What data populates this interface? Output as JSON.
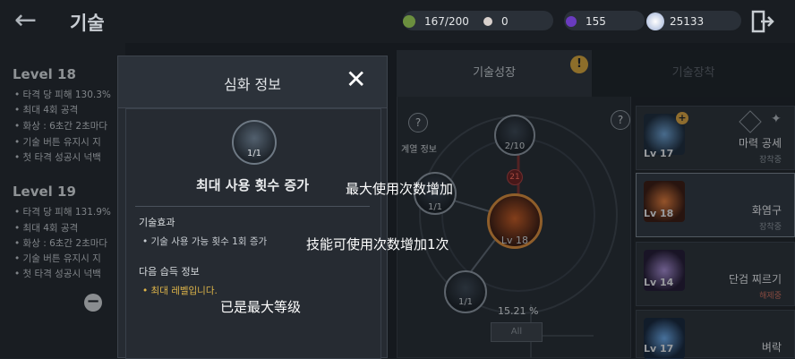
{
  "header": {
    "title": "기술"
  },
  "resources": [
    {
      "icon": "stamina-icon",
      "value": "167/200",
      "color": "#6b8f3e"
    },
    {
      "icon": "pearl-icon",
      "value": "0",
      "color": "#d8d0cc"
    },
    {
      "icon": "orb-icon",
      "value": "155",
      "color": "#6a3bbf"
    },
    {
      "icon": "crystal-icon",
      "value": "25133",
      "color": "#e8eef8"
    }
  ],
  "left": {
    "levels": [
      {
        "title": "Level 18",
        "lines": [
          "타격 당 피해 130.3%",
          "최대 4회 공격",
          "화상 : 6초간 2초마다",
          "기술 버튼 유지시 지",
          "첫 타격 성공시 넉백"
        ]
      },
      {
        "title": "Level 19",
        "lines": [
          "타격 당 피해 131.9%",
          "최대 4회 공격",
          "화상 : 6초간 2초마다",
          "기술 버튼 유지시 지",
          "첫 타격 성공시 넉백"
        ]
      }
    ]
  },
  "modal": {
    "title": "심화 정보",
    "skill_fraction": "1/1",
    "skill_name": "최대 사용 횟수 증가",
    "effect_header": "기술효과",
    "effect_line": "기술 사용 가능 횟수 1회 증가",
    "next_header": "다음 습득 정보",
    "next_line": "최대 레벨입니다."
  },
  "overlays": {
    "line1": "最大使用次数增加",
    "line2": "技能可使用次数增加1次",
    "line3": "已是最大等级"
  },
  "tabs": {
    "growth": "기술성장",
    "equip": "기술장착"
  },
  "tree": {
    "lineage_label": "계열 정보",
    "top_node": "2/10",
    "badge": "21",
    "left_node": "1/1",
    "center_level": "Lv 18",
    "bottom_node": "1/1",
    "percent": "15.21 %",
    "all_button": "All"
  },
  "skills": [
    {
      "level": "Lv 17",
      "name": "마력 공세",
      "status": "장착중",
      "color": "#3e6fa0",
      "has_plus": true,
      "status_color": "normal"
    },
    {
      "level": "Lv 18",
      "name": "화염구",
      "status": "장착중",
      "color": "#b3502a",
      "has_plus": false,
      "status_color": "normal"
    },
    {
      "level": "Lv 14",
      "name": "단검 찌르기",
      "status": "해제중",
      "color": "#7a5fa8",
      "has_plus": false,
      "status_color": "red"
    },
    {
      "level": "Lv 17",
      "name": "벼락",
      "status": "",
      "color": "#3a78c0",
      "has_plus": false,
      "status_color": "normal"
    }
  ]
}
